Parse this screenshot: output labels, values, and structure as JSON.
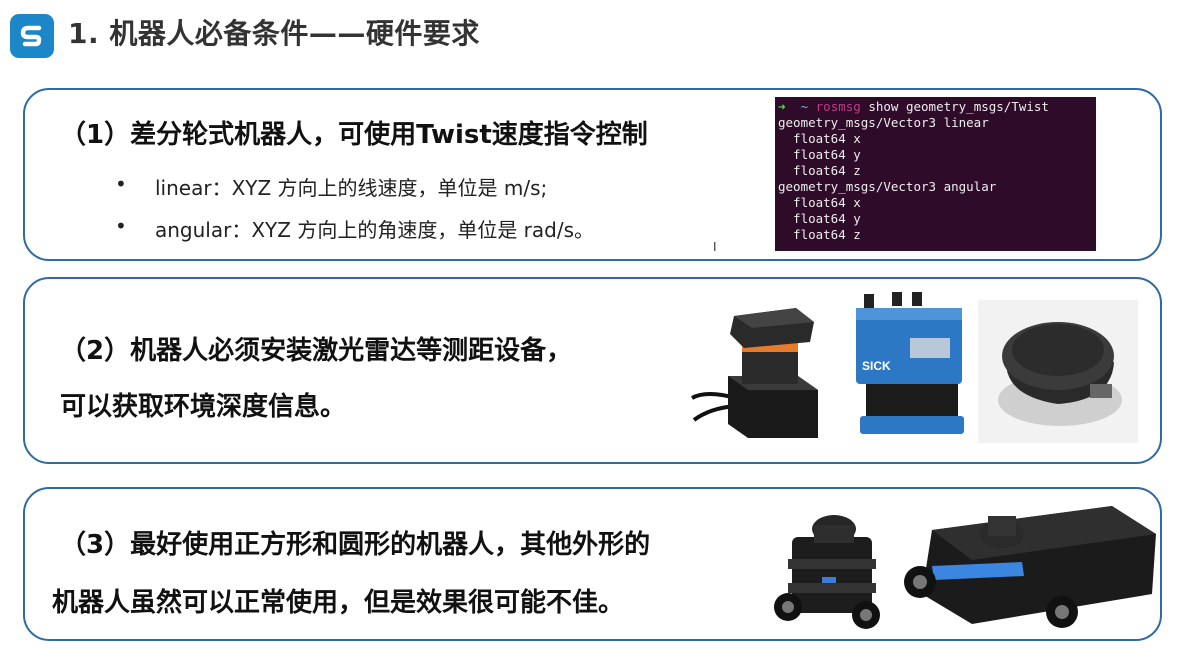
{
  "header": {
    "title": "1. 机器人必备条件——硬件要求",
    "logo_icon": "s-logo-icon"
  },
  "section1": {
    "heading": "（1）差分轮式机器人，可使用Twist速度指令控制",
    "bullets": [
      {
        "bullet": "•",
        "text": "linear：XYZ 方向上的线速度，单位是 m/s;"
      },
      {
        "bullet": "•",
        "text": "angular：XYZ 方向上的角速度，单位是 rad/s。"
      }
    ],
    "terminal": {
      "prompt_arrow": "➜",
      "prompt_tilde": "~",
      "prompt_cmd": "rosmsg",
      "prompt_rest": " show geometry_msgs/Twist",
      "lines": [
        "geometry_msgs/Vector3 linear",
        "  float64 x",
        "  float64 y",
        "  float64 z",
        "geometry_msgs/Vector3 angular",
        "  float64 x",
        "  float64 y",
        "  float64 z"
      ]
    },
    "cursor_glyph": "I"
  },
  "section2": {
    "heading_line1": "（2）机器人必须安装激光雷达等测距设备，",
    "heading_line2": "可以获取环境深度信息。",
    "images": [
      "hokuyo-lidar-image",
      "sick-lidar-image",
      "rplidar-image"
    ]
  },
  "section3": {
    "heading_line1": "（3）最好使用正方形和圆形的机器人，其他外形的",
    "heading_line2": "机器人虽然可以正常使用，但是效果很可能不佳。",
    "images": [
      "turtlebot3-burger-image",
      "turtlebot3-waffle-image"
    ]
  },
  "colors": {
    "panel_border": "#2f6aa6",
    "logo": "#1d86c8",
    "terminal_bg": "#2f0b2a"
  }
}
